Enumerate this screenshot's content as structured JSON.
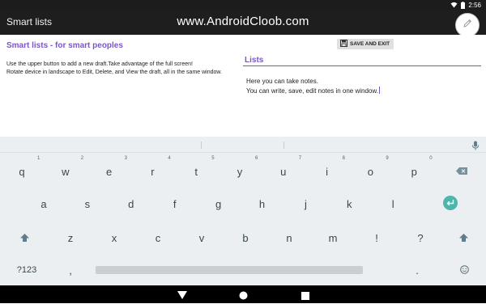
{
  "status_bar": {
    "time": "2:56"
  },
  "app_bar": {
    "title": "Smart lists",
    "watermark": "www.AndroidCloob.com",
    "fab_icon": "pencil-icon"
  },
  "left_panel": {
    "heading": "Smart lists - for smart peoples",
    "instruction_line1": "Use the upper button to add a new draft.Take advantage of the full screen!",
    "instruction_line2": "Rotate device in landscape to Edit, Delete, and View the draft, all in the same window."
  },
  "save_button": {
    "label": "SAVE AND EXIT",
    "icon": "floppy-disk-icon"
  },
  "right_panel": {
    "heading": "Lists",
    "note_line1": "Here you can take notes.",
    "note_line2": "You can write, save, edit notes in one window."
  },
  "keyboard": {
    "row1": [
      "q",
      "w",
      "e",
      "r",
      "t",
      "y",
      "u",
      "i",
      "o",
      "p"
    ],
    "row1_hints": [
      "1",
      "2",
      "3",
      "4",
      "5",
      "6",
      "7",
      "8",
      "9",
      "0"
    ],
    "row2": [
      "a",
      "s",
      "d",
      "f",
      "g",
      "h",
      "j",
      "k",
      "l"
    ],
    "row3": [
      "z",
      "x",
      "c",
      "v",
      "b",
      "n",
      "m",
      "!",
      "?"
    ],
    "symbols_label": "?123",
    "comma": ",",
    "period": ".",
    "shift_icon": "shift-icon",
    "backspace_icon": "backspace-icon",
    "enter_icon": "enter-icon",
    "emoji_icon": "emoji-icon",
    "mic_icon": "mic-icon",
    "accent_color": "#4db6ac"
  },
  "nav_bar": {
    "back_icon": "back-icon",
    "home_icon": "home-icon",
    "recents_icon": "recents-icon"
  },
  "colors": {
    "accent_purple": "#7b55c7",
    "app_bar": "#1e1e1e",
    "keyboard_bg": "#eceff1"
  }
}
